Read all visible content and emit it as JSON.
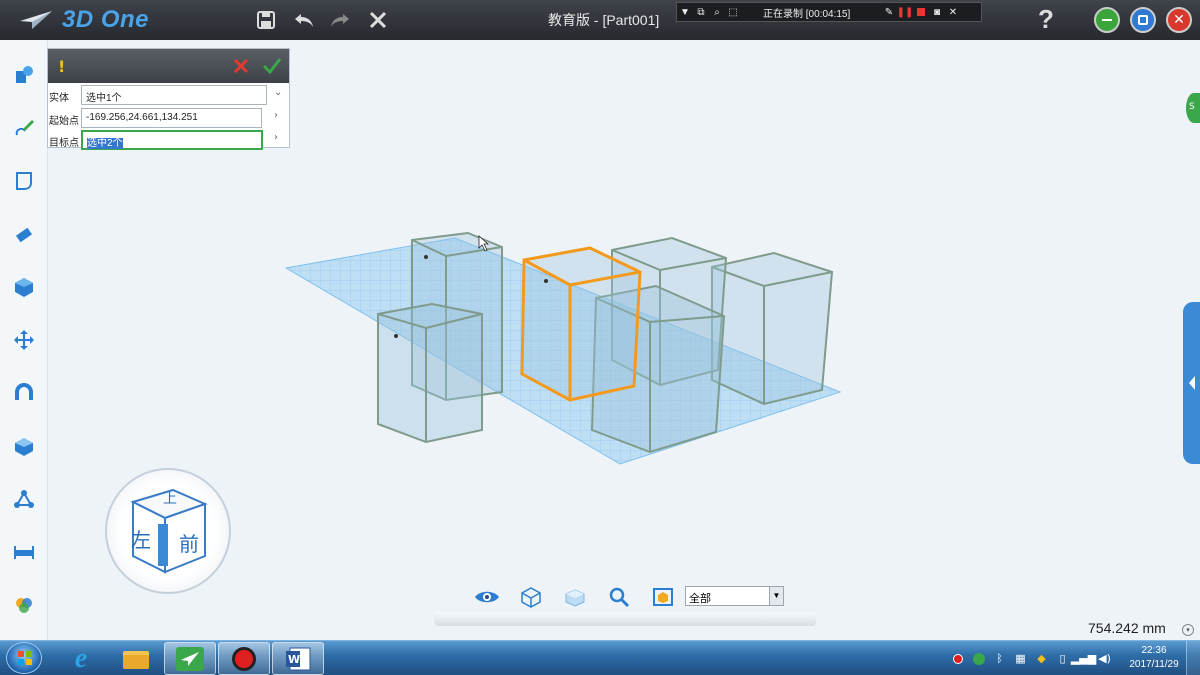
{
  "app": {
    "logo_text": "3D One",
    "title": "教育版 - [Part001]",
    "help_label": "?"
  },
  "recorder": {
    "status": "正在录制 [00:04:15]"
  },
  "command_panel": {
    "warn_symbol": "!",
    "fields": [
      {
        "label": "实体",
        "value": "选中1个"
      },
      {
        "label": "起始点",
        "value": "-169.256,24.661,134.251"
      },
      {
        "label": "目标点",
        "value": "选中2个"
      }
    ]
  },
  "viewcube": {
    "face_top": "上",
    "face_left": "左",
    "face_front": "前"
  },
  "viewbar": {
    "filter_value": "全部"
  },
  "status": {
    "zoom": "754.242 mm"
  },
  "taskbar": {
    "time": "22:36",
    "date": "2017/11/29"
  },
  "colors": {
    "selection": "#f39a1e",
    "accent": "#3a8ad6",
    "grid": "#5ab0e8"
  }
}
